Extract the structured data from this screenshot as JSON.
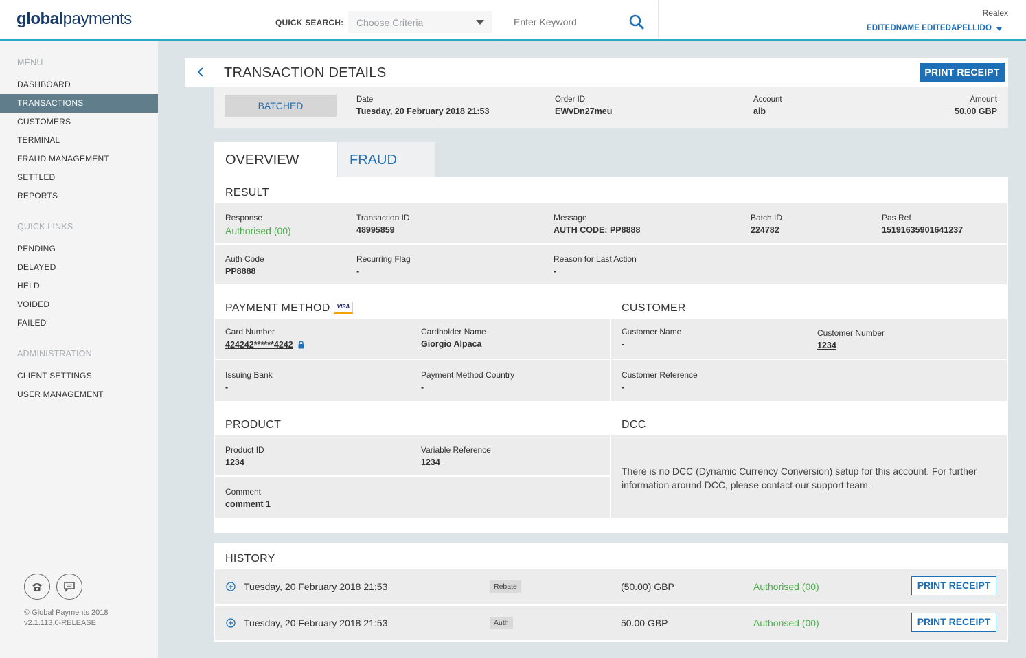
{
  "header": {
    "logo_bold": "global",
    "logo_light": "payments",
    "quick_search_label": "QUICK SEARCH:",
    "criteria_placeholder": "Choose Criteria",
    "keyword_placeholder": "Enter Keyword",
    "merchant": "Realex",
    "user_name": "EDITEDNAME EDITEDAPELLIDO"
  },
  "sidebar": {
    "menu_title": "MENU",
    "menu_items": [
      "DASHBOARD",
      "TRANSACTIONS",
      "CUSTOMERS",
      "TERMINAL",
      "FRAUD MANAGEMENT",
      "SETTLED",
      "REPORTS"
    ],
    "active_item": "TRANSACTIONS",
    "quick_links_title": "QUICK LINKS",
    "quick_links": [
      "PENDING",
      "DELAYED",
      "HELD",
      "VOIDED",
      "FAILED"
    ],
    "admin_title": "ADMINISTRATION",
    "admin_items": [
      "CLIENT SETTINGS",
      "USER MANAGEMENT"
    ],
    "copyright": "© Global Payments 2018",
    "version": "v2.1.113.0-RELEASE"
  },
  "page": {
    "title": "TRANSACTION DETAILS",
    "print_receipt": "PRINT RECEIPT"
  },
  "summary": {
    "status": "BATCHED",
    "date_label": "Date",
    "date_value": "Tuesday, 20 February 2018 21:53",
    "order_label": "Order ID",
    "order_value": "EWvDn27meu",
    "account_label": "Account",
    "account_value": "aib",
    "amount_label": "Amount",
    "amount_value": "50.00 GBP"
  },
  "tabs": {
    "overview": "OVERVIEW",
    "fraud": "FRAUD"
  },
  "result": {
    "title": "RESULT",
    "response_label": "Response",
    "response_value": "Authorised (00)",
    "txn_label": "Transaction ID",
    "txn_value": "48995859",
    "message_label": "Message",
    "message_value": "AUTH CODE: PP8888",
    "batch_label": "Batch ID",
    "batch_value": "224782",
    "pasref_label": "Pas Ref",
    "pasref_value": "15191635901641237",
    "auth_label": "Auth Code",
    "auth_value": "PP8888",
    "recurring_label": "Recurring Flag",
    "recurring_value": "-",
    "reason_label": "Reason for Last Action",
    "reason_value": "-"
  },
  "payment": {
    "title": "PAYMENT METHOD",
    "card_brand": "VISA",
    "card_label": "Card Number",
    "card_value": "424242******4242",
    "holder_label": "Cardholder Name",
    "holder_value": "Giorgio Alpaca",
    "bank_label": "Issuing Bank",
    "bank_value": "-",
    "country_label": "Payment Method Country",
    "country_value": "-"
  },
  "customer": {
    "title": "CUSTOMER",
    "name_label": "Customer Name",
    "name_value": "-",
    "number_label": "Customer Number",
    "number_value": "1234",
    "ref_label": "Customer Reference",
    "ref_value": "-"
  },
  "product": {
    "title": "PRODUCT",
    "id_label": "Product ID",
    "id_value": "1234",
    "varref_label": "Variable Reference",
    "varref_value": "1234",
    "comment_label": "Comment",
    "comment_value": "comment 1"
  },
  "dcc": {
    "title": "DCC",
    "text_line1": "There is no DCC (Dynamic Currency Conversion) setup for this account. For further",
    "text_line2": "information around DCC, please contact our support team."
  },
  "history": {
    "title": "HISTORY",
    "rows": [
      {
        "date": "Tuesday, 20 February 2018 21:53",
        "type": "Rebate",
        "amount": "(50.00) GBP",
        "status": "Authorised (00)",
        "button": "PRINT RECEIPT"
      },
      {
        "date": "Tuesday, 20 February 2018 21:53",
        "type": "Auth",
        "amount": "50.00 GBP",
        "status": "Authorised (00)",
        "button": "PRINT RECEIPT"
      }
    ]
  },
  "colors": {
    "accent": "#1d6fb8",
    "header_border": "#29a9c2",
    "sidebar_active": "#607d8b",
    "success": "#4cae4c"
  }
}
